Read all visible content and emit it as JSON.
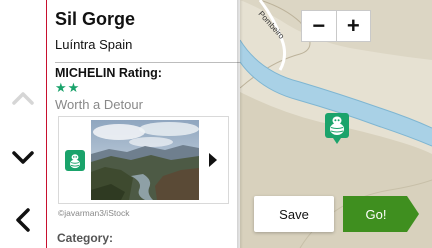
{
  "place": {
    "title": "Sil Gorge",
    "location": "Luíntra Spain"
  },
  "rating": {
    "heading": "MICHELIN Rating:",
    "stars": 2,
    "stars_text": "★★",
    "description": "Worth a Detour"
  },
  "photo": {
    "credit": "©javarman3/iStock"
  },
  "category": {
    "heading": "Category:"
  },
  "map": {
    "street_label": "Pombeiro",
    "zoom_out_label": "−",
    "zoom_in_label": "+"
  },
  "actions": {
    "save_label": "Save",
    "go_label": "Go!"
  },
  "icons": {
    "nav_up": "chevron-up-icon",
    "nav_down": "chevron-down-icon",
    "back": "chevron-left-icon",
    "carousel_next": "triangle-right-icon",
    "michelin": "michelin-bibendum-icon",
    "map_pin": "map-pin-icon"
  },
  "colors": {
    "accent_green": "#1aa36b",
    "go_green": "#3f8f1f",
    "divider_red": "#c8102e"
  }
}
